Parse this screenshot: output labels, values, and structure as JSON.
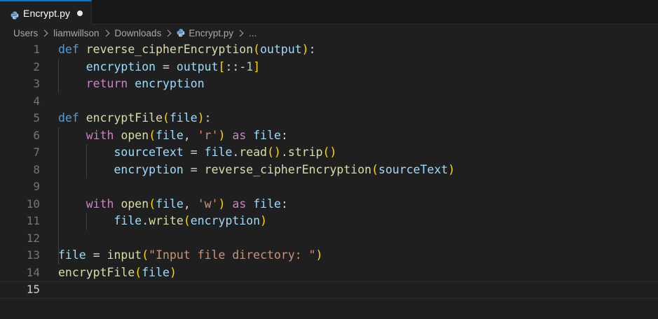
{
  "tab": {
    "label": "Encrypt.py",
    "icon": "python-icon",
    "unsaved": true
  },
  "breadcrumb": {
    "items": [
      "Users",
      "liamwillson",
      "Downloads",
      "Encrypt.py",
      "..."
    ]
  },
  "editor": {
    "language": "python",
    "current_line": 15,
    "lines": [
      {
        "n": "1",
        "text": "def reverse_cipherEncryption(output):"
      },
      {
        "n": "2",
        "text": "    encryption = output[::-1]"
      },
      {
        "n": "3",
        "text": "    return encryption"
      },
      {
        "n": "4",
        "text": ""
      },
      {
        "n": "5",
        "text": "def encryptFile(file):"
      },
      {
        "n": "6",
        "text": "    with open(file, 'r') as file:"
      },
      {
        "n": "7",
        "text": "        sourceText = file.read().strip()"
      },
      {
        "n": "8",
        "text": "        encryption = reverse_cipherEncryption(sourceText)"
      },
      {
        "n": "9",
        "text": ""
      },
      {
        "n": "10",
        "text": "    with open(file, 'w') as file:"
      },
      {
        "n": "11",
        "text": "        file.write(encryption)"
      },
      {
        "n": "12",
        "text": ""
      },
      {
        "n": "13",
        "text": "file = input(\"Input file directory: \")"
      },
      {
        "n": "14",
        "text": "encryptFile(file)"
      },
      {
        "n": "15",
        "text": ""
      }
    ]
  },
  "colors": {
    "editor_bg": "#1f1f1f",
    "tab_accent": "#0078d4",
    "keyword": "#569cd6",
    "control_keyword": "#c586c0",
    "function": "#dcdcaa",
    "variable": "#9cdcfe",
    "string": "#ce9178",
    "number": "#b5cea8"
  }
}
